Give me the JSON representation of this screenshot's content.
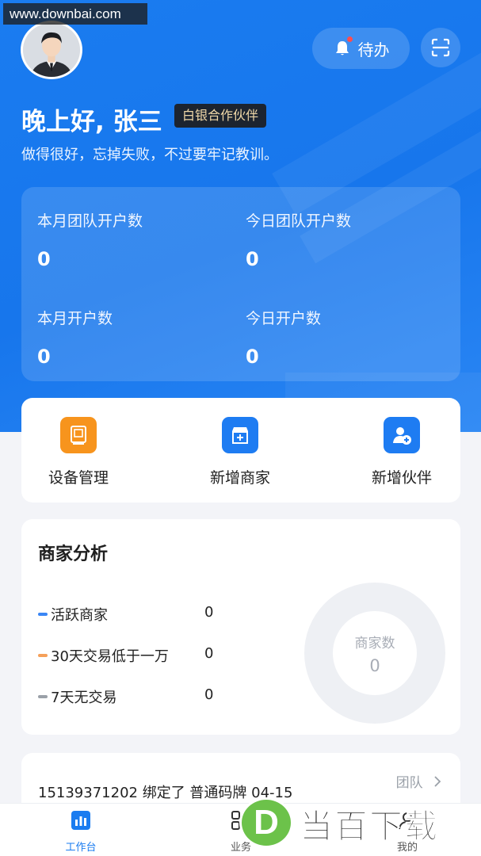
{
  "watermark": "www.downbai.com",
  "header": {
    "todo_label": "待办",
    "greeting": "晚上好, 张三",
    "badge": "白银合作伙伴",
    "motto": "做得很好，忘掉失败，不过要牢记教训。"
  },
  "stats": [
    {
      "label": "本月团队开户数",
      "value": "0"
    },
    {
      "label": "今日团队开户数",
      "value": "0"
    },
    {
      "label": "本月开户数",
      "value": "0"
    },
    {
      "label": "今日开户数",
      "value": "0"
    }
  ],
  "quick_actions": [
    {
      "label": "设备管理",
      "icon": "device-icon",
      "color": "#f7941d"
    },
    {
      "label": "新增商家",
      "icon": "store-add-icon",
      "color": "#1e7cf2"
    },
    {
      "label": "新增伙伴",
      "icon": "user-add-icon",
      "color": "#1e7cf2"
    }
  ],
  "analysis": {
    "title": "商家分析",
    "legend": [
      {
        "label": "活跃商家",
        "value": "0",
        "color": "#3a86f5"
      },
      {
        "label": "30天交易低于一万",
        "value": "0",
        "color": "#f5a05a"
      },
      {
        "label": "7天无交易",
        "value": "0",
        "color": "#9aa0a8"
      }
    ],
    "donut_label": "商家数",
    "donut_value": "0"
  },
  "notice": {
    "team_label": "团队",
    "message": "15139371202 绑定了 普通码牌 04-15"
  },
  "tabs": [
    {
      "label": "工作台",
      "icon": "dashboard-icon",
      "active": true
    },
    {
      "label": "业务",
      "icon": "grid-icon",
      "active": false
    },
    {
      "label": "我的",
      "icon": "profile-icon",
      "active": false
    }
  ],
  "site_logo": {
    "letter": "D",
    "text": "当百下载"
  },
  "colors": {
    "primary": "#1a7cf0",
    "badge_bg": "#1c2430",
    "badge_text": "#f0d8a8"
  }
}
